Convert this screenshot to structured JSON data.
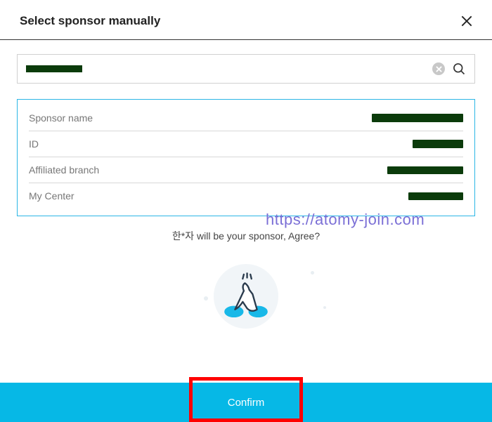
{
  "header": {
    "title": "Select sponsor manually"
  },
  "search": {
    "value": "████████",
    "placeholder": ""
  },
  "card": {
    "rows": [
      {
        "label": "Sponsor name"
      },
      {
        "label": "ID"
      },
      {
        "label": "Affiliated branch"
      },
      {
        "label": "My Center"
      }
    ]
  },
  "agree": {
    "prefix": "한*자",
    "suffix": " will be your sponsor, Agree?"
  },
  "watermark": "https://atomy-join.com",
  "confirm": {
    "label": "Confirm"
  }
}
